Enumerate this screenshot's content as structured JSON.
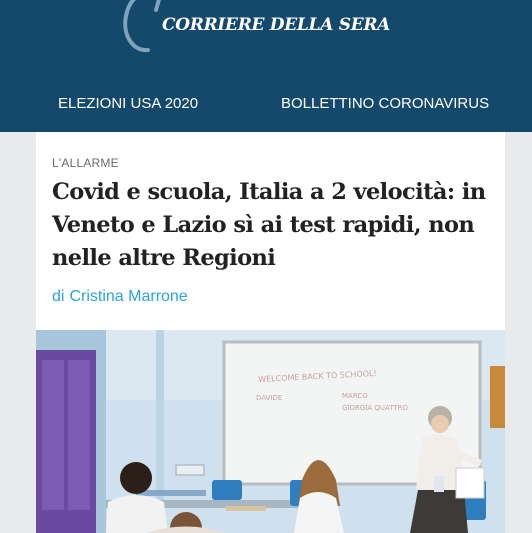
{
  "header": {
    "logo_text": "CORRIERE DELLA SERA",
    "background": "#15496b"
  },
  "nav": {
    "items": [
      {
        "label": "ELEZIONI USA 2020"
      },
      {
        "label": "BOLLETTINO CORONAVIRUS"
      }
    ]
  },
  "article": {
    "kicker": "L'ALLARME",
    "headline": "Covid e scuola, Italia a 2 velocità: in Veneto e Lazio sì ai test rapidi, non nelle altre Regioni",
    "byline_prefix": "di",
    "author": "Cristina Marrone",
    "author_color": "#2ba3e0",
    "photo": {
      "board_text_line1": "WELCOME BACK TO SCHOOL!",
      "board_text_line2": "DAVIDE",
      "board_text_line3": "MARCO",
      "board_text_line4": "GIORGIA QUATTRO"
    }
  }
}
